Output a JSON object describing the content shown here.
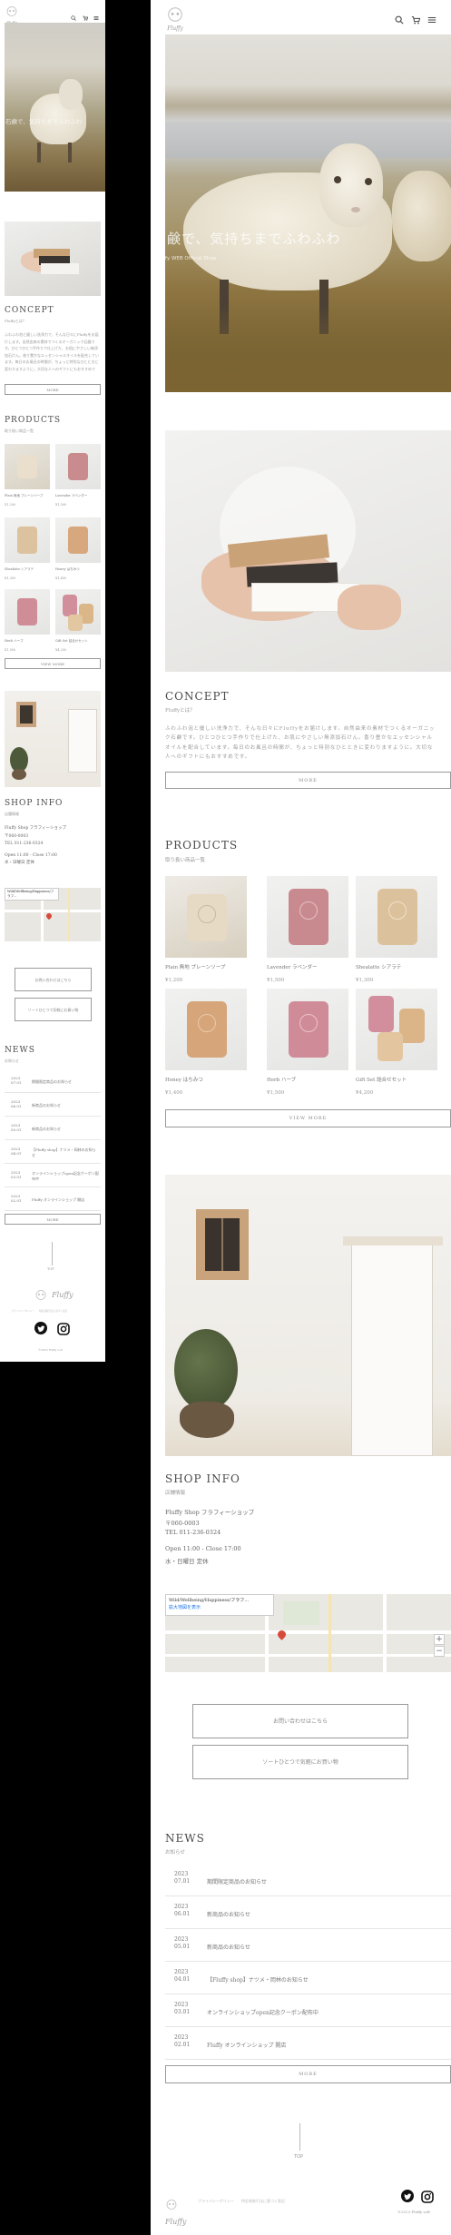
{
  "brand": {
    "logo_text": "Fluffy",
    "footer_links_text": "プライバシーポリシー　　特定商取引法に基づく表記",
    "copyright": "©2023 Fluffy soft"
  },
  "header": {
    "icons": [
      "search-icon",
      "cart-icon",
      "menu-icon"
    ]
  },
  "hero": {
    "headline": "石鹸で、気持ちまでふわふわ",
    "subline": "Fluffy WEB Official Shop"
  },
  "concept": {
    "title": "CONCEPT",
    "subtitle": "Fluffyとは？",
    "body": "ふわふわ泡と優しい洗浄力で、そんな日々にFluffyをお届けします。自然由来の素材でつくるオーガニック石鹸です。ひとつひとつ手作りで仕上げた、お肌にやさしい無添加石けん。香り豊かなエッセンシャルオイルを配合しています。毎日のお風呂の時間が、ちょっと特別なひとときに変わりますように。大切な人へのギフトにもおすすめです。",
    "button": "MORE"
  },
  "products": {
    "title": "PRODUCTS",
    "subtitle": "取り扱い商品一覧",
    "items": [
      {
        "name": "Plain 無地 プレーンソープ",
        "price": "¥1,200"
      },
      {
        "name": "Lavender ラベンダー",
        "price": "¥1,500"
      },
      {
        "name": "Shealatte シアラテ",
        "price": "¥1,300"
      },
      {
        "name": "Honey はちみつ",
        "price": "¥1,400"
      },
      {
        "name": "Herb ハーブ",
        "price": "¥1,500"
      },
      {
        "name": "Gift Set 詰合せセット",
        "price": "¥4,200"
      }
    ],
    "button": "VIEW MORE"
  },
  "shop": {
    "title": "SHOP INFO",
    "subtitle": "店舗情報",
    "name": "Fluffy Shop フラフィーショップ",
    "zip": "〒060-0003",
    "tel": "TEL 011-236-0324",
    "hours": "Open 11:00 - Close 17:00",
    "holiday": "水・日曜日 定休",
    "map_pin": "Wild/Wellbeing/Happiness/フラフ...",
    "map_link": "拡大地図を表示",
    "contact_button": "お問い合わせはこちら",
    "online_button": "ソートひとつで気軽にお買い物"
  },
  "news": {
    "title": "NEWS",
    "subtitle": "お知らせ",
    "items": [
      {
        "year": "2023",
        "date": "07.01",
        "title": "期間限定商品のお知らせ"
      },
      {
        "year": "2023",
        "date": "06.01",
        "title": "新商品のお知らせ"
      },
      {
        "year": "2023",
        "date": "05.01",
        "title": "新商品のお知らせ"
      },
      {
        "year": "2023",
        "date": "04.01",
        "title": "【Fluffy shop】ナツメ・岡林のお知らせ"
      },
      {
        "year": "2023",
        "date": "03.01",
        "title": "オンラインショップopen記念クーポン配布中"
      },
      {
        "year": "2023",
        "date": "02.01",
        "title": "Fluffy オンラインショップ 開店"
      }
    ],
    "button": "MORE"
  },
  "pagetop": {
    "label": "TOP"
  },
  "colors": {
    "background": "#ffffff",
    "frame": "#000000",
    "text": "#555555",
    "line": "#9a9a9a"
  }
}
